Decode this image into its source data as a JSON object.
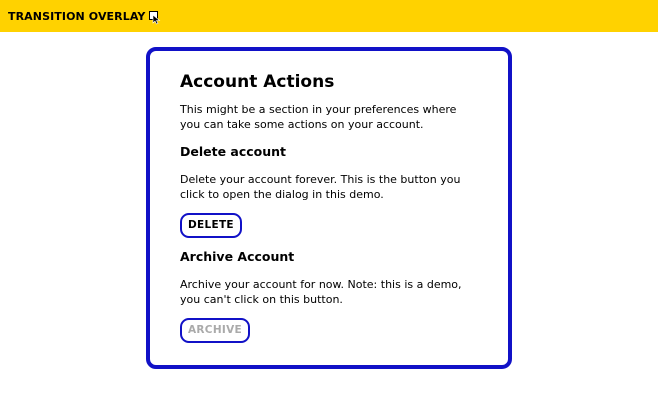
{
  "header": {
    "title": "TRANSITION OVERLAY",
    "icon": "cursor-pointer-icon",
    "background_color": "#FFD200"
  },
  "card": {
    "border_color": "#1111C7",
    "title": "Account Actions",
    "intro": "This might be a section in your preferences where you can take some actions on your account.",
    "delete_section": {
      "heading": "Delete account",
      "description": "Delete your account forever. This is the button you click to open the dialog in this demo.",
      "button_label": "DELETE"
    },
    "archive_section": {
      "heading": "Archive Account",
      "description": "Archive your account for now. Note: this is a demo, you can't click on this button.",
      "button_label": "ARCHIVE",
      "button_disabled": true
    }
  }
}
